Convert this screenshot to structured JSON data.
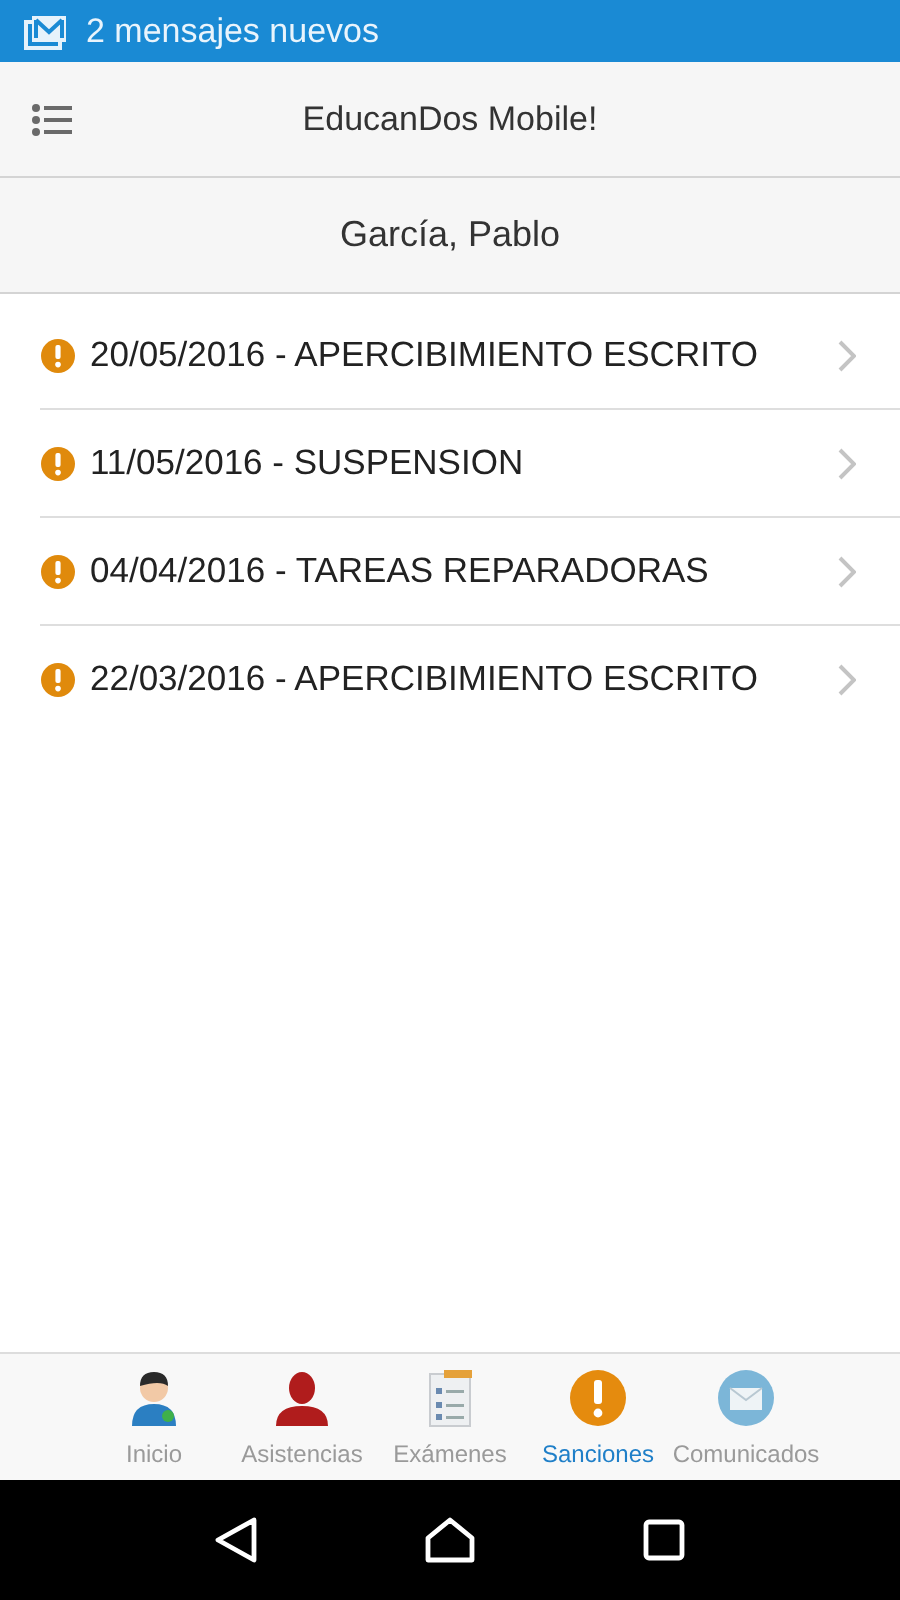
{
  "notification": {
    "text": "2 mensajes nuevos"
  },
  "header": {
    "title": "EducanDos Mobile!"
  },
  "student": {
    "name": "García, Pablo"
  },
  "sanctions": [
    {
      "text": "20/05/2016 - APERCIBIMIENTO ESCRITO"
    },
    {
      "text": "11/05/2016 - SUSPENSION"
    },
    {
      "text": "04/04/2016 - TAREAS REPARADORAS"
    },
    {
      "text": "22/03/2016 - APERCIBIMIENTO ESCRITO"
    }
  ],
  "tabs": [
    {
      "label": "Inicio",
      "kind": "home",
      "selected": false
    },
    {
      "label": "Asistencias",
      "kind": "attendance",
      "selected": false
    },
    {
      "label": "Exámenes",
      "kind": "exams",
      "selected": false
    },
    {
      "label": "Sanciones",
      "kind": "sanctions",
      "selected": true
    },
    {
      "label": "Comunicados",
      "kind": "messages",
      "selected": false
    }
  ]
}
